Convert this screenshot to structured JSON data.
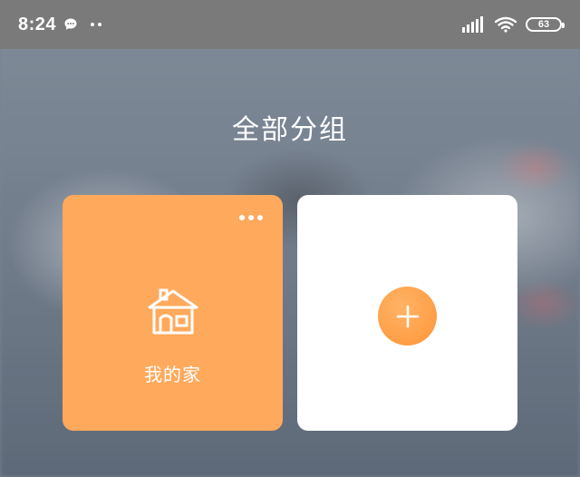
{
  "status_bar": {
    "time": "8:24",
    "battery_level": "63",
    "icons": [
      "message-bubble-icon",
      "more-dots-icon",
      "signal-icon",
      "wifi-icon",
      "battery-icon"
    ]
  },
  "page": {
    "title": "全部分组"
  },
  "groups": [
    {
      "label": "我的家",
      "icon": "house-icon",
      "color": "#ffa95c",
      "menu_icon": "more-horizontal-icon"
    }
  ],
  "add_card": {
    "icon": "plus-icon",
    "accent": "#ff9e45"
  }
}
